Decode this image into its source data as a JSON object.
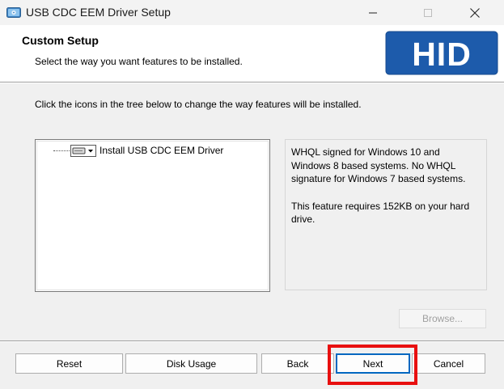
{
  "window": {
    "title": "USB CDC EEM Driver Setup",
    "icons": {
      "app": "setup-disk-icon",
      "minimize": "minimize-icon",
      "maximize": "maximize-icon",
      "close": "close-icon"
    }
  },
  "header": {
    "title": "Custom Setup",
    "subtitle": "Select the way you want features to be installed.",
    "logo_text": "HID",
    "logo_color": "#1d5bab"
  },
  "main": {
    "instruction": "Click the icons in the tree below to change the way features will be installed.",
    "tree": {
      "items": [
        {
          "label": "Install USB CDC EEM Driver",
          "icon": "hard-drive-dropdown-icon"
        }
      ]
    },
    "description": {
      "line1": "WHQL signed for Windows 10 and Windows 8 based systems. No WHQL signature for Windows 7 based systems.",
      "line2": "This feature requires 152KB on your hard drive."
    },
    "browse_label": "Browse..."
  },
  "footer": {
    "buttons": {
      "reset": "Reset",
      "disk_usage": "Disk Usage",
      "back": "Back",
      "next": "Next",
      "cancel": "Cancel"
    },
    "highlight_color": "#e81010"
  }
}
